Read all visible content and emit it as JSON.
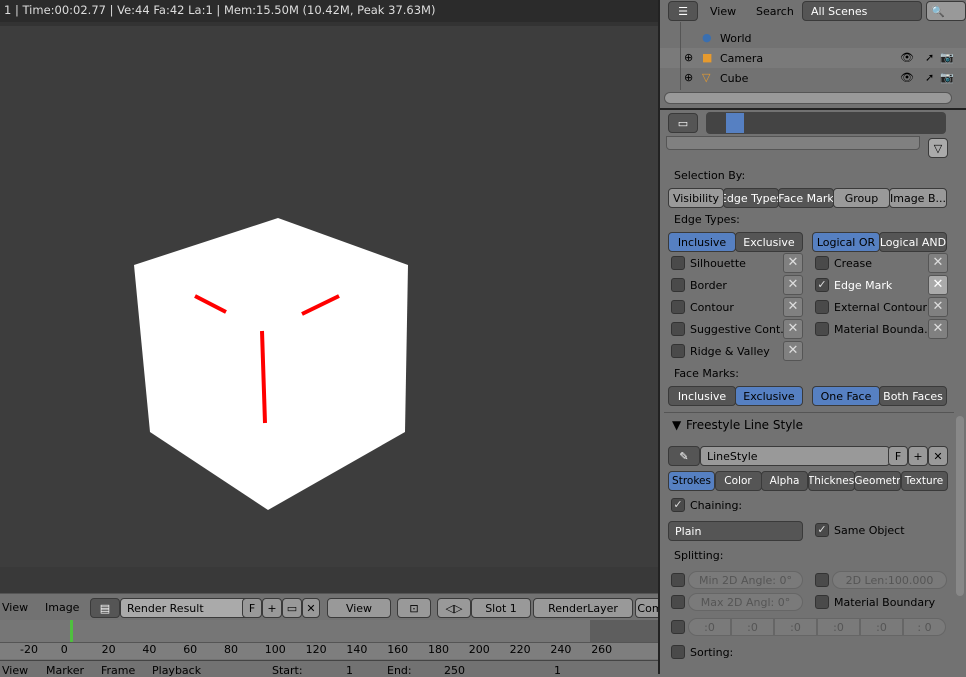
{
  "status": "1 | Time:00:02.77 | Ve:44 Fa:42 La:1 | Mem:15.50M (10.42M, Peak 37.63M)",
  "image_editor": {
    "menu": [
      "View",
      "Image"
    ],
    "image_name": "Render Result",
    "fake_user": "F",
    "view": "View",
    "slot": "Slot 1",
    "layer": "RenderLayer",
    "composite": "Com"
  },
  "timeline": {
    "ticks": [
      "-20",
      "0",
      "20",
      "40",
      "60",
      "80",
      "100",
      "120",
      "140",
      "160",
      "180",
      "200",
      "220",
      "240",
      "260"
    ],
    "current_frame_color": "#4fbf3f",
    "menu": [
      "View",
      "Marker",
      "Frame",
      "Playback"
    ],
    "start_label": "Start:",
    "start": "1",
    "end_label": "End:",
    "end": "250",
    "current": "1"
  },
  "outliner": {
    "menu": [
      "View",
      "Search"
    ],
    "scene_filter": "All Scenes",
    "items": [
      {
        "name": "World",
        "icon": "world-icon"
      },
      {
        "name": "Camera",
        "icon": "camera-icon"
      },
      {
        "name": "Cube",
        "icon": "mesh-icon"
      }
    ]
  },
  "properties": {
    "selection_by_label": "Selection By:",
    "selection_by": [
      {
        "label": "Visibility",
        "on": false
      },
      {
        "label": "Edge Types",
        "on": true
      },
      {
        "label": "Face Mark",
        "on": true
      },
      {
        "label": "Group",
        "on": false
      },
      {
        "label": "Image B...",
        "on": false
      }
    ],
    "edge_types_label": "Edge Types:",
    "edge_mode": [
      "Inclusive",
      "Exclusive"
    ],
    "edge_logic": [
      "Logical OR",
      "Logical AND"
    ],
    "edges_left": [
      "Silhouette",
      "Border",
      "Contour",
      "Suggestive Cont...",
      "Ridge & Valley"
    ],
    "edges_right": [
      "Crease",
      "Edge Mark",
      "External Contour",
      "Material Bounda..."
    ],
    "edge_mark_checked": true,
    "face_marks_label": "Face Marks:",
    "face_mode": [
      "Inclusive",
      "Exclusive"
    ],
    "face_which": [
      "One Face",
      "Both Faces"
    ],
    "linestyle_panel": "Freestyle Line Style",
    "linestyle_name": "LineStyle",
    "linestyle_f": "F",
    "tabs": [
      "Strokes",
      "Color",
      "Alpha",
      "Thicknes",
      "Geometr",
      "Texture"
    ],
    "chaining": "Chaining:",
    "chaining_mode": "Plain",
    "same_object": "Same Object",
    "splitting": "Splitting:",
    "min_angle": "Min 2D Angle: 0°",
    "max_angle": "Max 2D Angl:  0°",
    "len": "2D Len:100.000",
    "material_boundary": "Material Boundary",
    "dash": [
      ":0",
      ":0",
      ":0",
      ":0",
      ":0",
      ": 0"
    ],
    "sorting": "Sorting:"
  },
  "colors": {
    "accent": "#5680c2",
    "edge_line": "#ff0000"
  }
}
